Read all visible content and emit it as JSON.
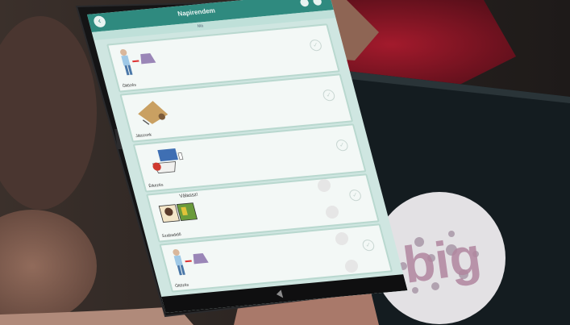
{
  "scene": {
    "description_hidden": ""
  },
  "app": {
    "title": "Napirendem",
    "tab_left": "Ma",
    "tab_right": ""
  },
  "cards": [
    {
      "label": "Öltözés",
      "icon": "person-dressing-icon"
    },
    {
      "label": "Játszunk",
      "icon": "play-icon"
    },
    {
      "label": "Étkezés",
      "icon": "meal-icon"
    },
    {
      "label": "Szabadidő",
      "icon": "leisure-icon",
      "note": "Válassz!"
    },
    {
      "label": "Öltözés",
      "icon": "person-dressing-icon"
    }
  ],
  "side_buttons": [
    "",
    "",
    "",
    ""
  ],
  "logo_text": "big",
  "colors": {
    "appbar": "#2f8a7f",
    "screen_bg": "#cfe6e1",
    "card_bg": "#f3f8f6",
    "bezel": "#141415"
  }
}
